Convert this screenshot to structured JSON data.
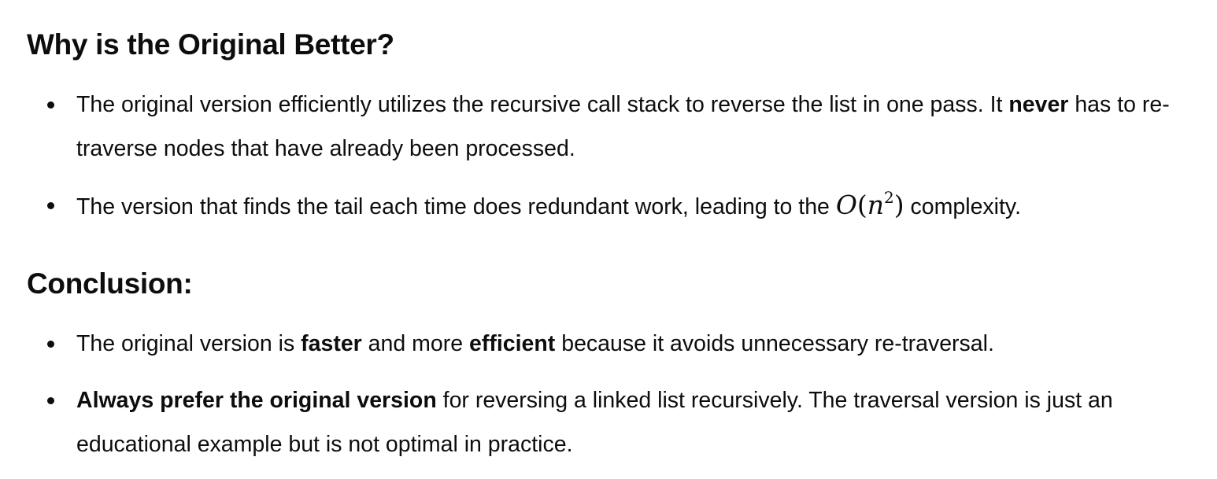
{
  "section_why": {
    "heading": "Why is the Original Better?",
    "bullets": [
      {
        "parts": [
          "The original version efficiently utilizes the recursive call stack to reverse the list in one pass. It ",
          "never",
          " has to re-traverse nodes that have already been processed."
        ]
      },
      {
        "parts": [
          "The version that finds the tail each time does redundant work, leading to the ",
          " complexity."
        ],
        "math": {
          "o": "O",
          "open": "(",
          "var": "n",
          "exp": "2",
          "close": ")"
        }
      }
    ]
  },
  "section_conclusion": {
    "heading": "Conclusion:",
    "bullets": [
      {
        "parts": [
          "The original version is ",
          "faster",
          " and more ",
          "efficient",
          " because it avoids unnecessary re-traversal."
        ]
      },
      {
        "parts": [
          "Always prefer the original version",
          " for reversing a linked list recursively. The traversal version is just an educational example but is not optimal in practice."
        ]
      }
    ]
  }
}
